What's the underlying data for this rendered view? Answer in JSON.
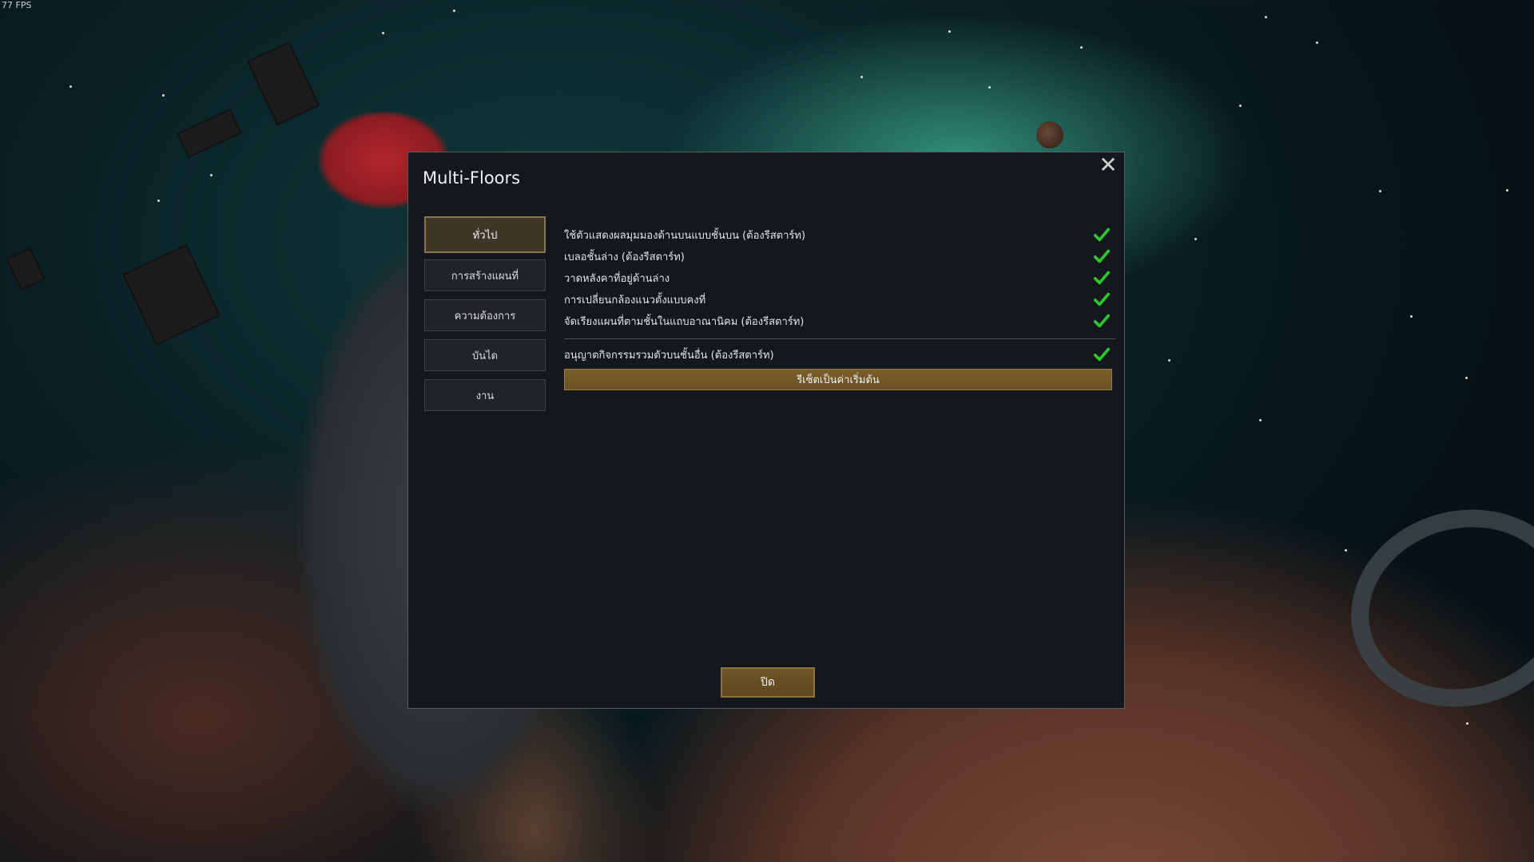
{
  "hud": {
    "fps": "77 FPS"
  },
  "dialog": {
    "title": "Multi-Floors",
    "tabs": [
      {
        "label": "ทั่วไป",
        "active": true
      },
      {
        "label": "การสร้างแผนที่",
        "active": false
      },
      {
        "label": "ความต้องการ",
        "active": false
      },
      {
        "label": "บันได",
        "active": false
      },
      {
        "label": "งาน",
        "active": false
      }
    ],
    "options": [
      {
        "label": "ใช้ตัวแสดงผลมุมมองด้านบนแบบชั้นบน (ต้องรีสตาร์ท)",
        "checked": true
      },
      {
        "label": "เบลอชั้นล่าง (ต้องรีสตาร์ท)",
        "checked": true
      },
      {
        "label": "วาดหลังคาที่อยู่ด้านล่าง",
        "checked": true
      },
      {
        "label": "การเปลี่ยนกล้องแนวตั้งแบบคงที่",
        "checked": true
      },
      {
        "label": "จัดเรียงแผนที่ตามชั้นในแถบอาณานิคม (ต้องรีสตาร์ท)",
        "checked": true
      }
    ],
    "extra_option": {
      "label": "อนุญาตกิจกรรมรวมตัวบนชั้นอื่น (ต้องรีสตาร์ท)",
      "checked": true
    },
    "reset_label": "รีเซ็ตเป็นค่าเริ่มต้น",
    "close_label": "ปิด",
    "colors": {
      "check": "#2fc52f",
      "accent": "#8b7350"
    }
  }
}
